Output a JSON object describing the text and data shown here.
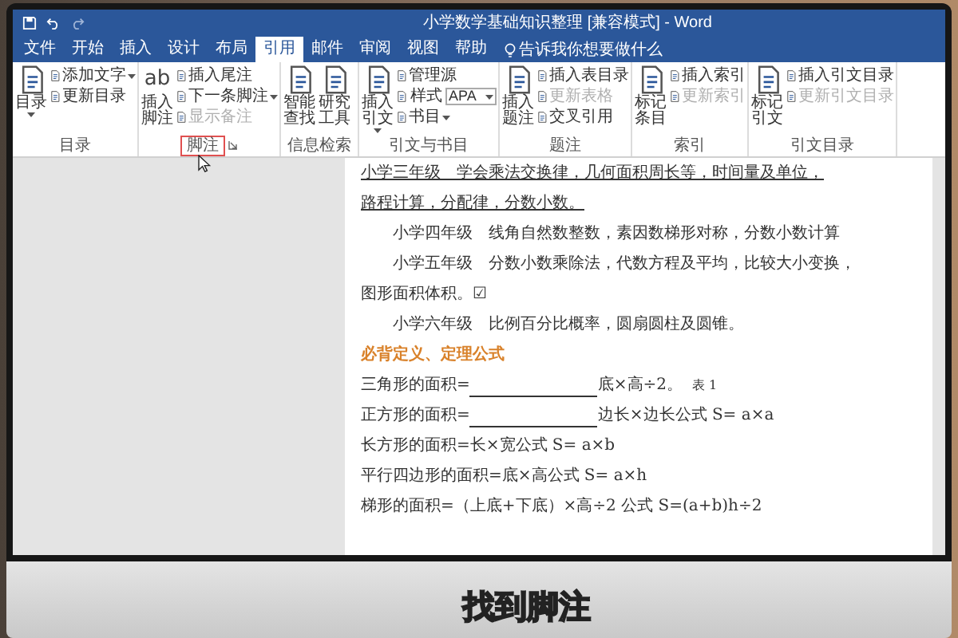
{
  "window": {
    "title": "小学数学基础知识整理 [兼容模式] - Word"
  },
  "tabs": [
    {
      "label": "文件",
      "selected": false
    },
    {
      "label": "开始",
      "selected": false
    },
    {
      "label": "插入",
      "selected": false
    },
    {
      "label": "设计",
      "selected": false
    },
    {
      "label": "布局",
      "selected": false
    },
    {
      "label": "引用",
      "selected": true
    },
    {
      "label": "邮件",
      "selected": false
    },
    {
      "label": "审阅",
      "selected": false
    },
    {
      "label": "视图",
      "selected": false
    },
    {
      "label": "帮助",
      "selected": false
    }
  ],
  "tell_me": "告诉我你想要做什么",
  "ribbon_groups": [
    {
      "label": "目录",
      "highlighted": false,
      "big": [
        {
          "label": "目录",
          "dropdown": true
        }
      ],
      "small": [
        {
          "label": "添加文字",
          "disabled": false,
          "dropdown": true
        },
        {
          "label": "更新目录",
          "disabled": false,
          "dropdown": false
        }
      ]
    },
    {
      "label": "脚注",
      "highlighted": true,
      "launcher": true,
      "big": [
        {
          "label": "插入脚注",
          "dropdown": false,
          "icon_text": "ab"
        }
      ],
      "small": [
        {
          "label": "插入尾注",
          "disabled": false,
          "dropdown": false
        },
        {
          "label": "下一条脚注",
          "disabled": false,
          "dropdown": true
        },
        {
          "label": "显示备注",
          "disabled": true,
          "dropdown": false
        }
      ]
    },
    {
      "label": "信息检索",
      "highlighted": false,
      "big": [
        {
          "label": "智能查找",
          "dropdown": false
        },
        {
          "label": "研究工具",
          "dropdown": false
        }
      ]
    },
    {
      "label": "引文与书目",
      "highlighted": false,
      "big": [
        {
          "label": "插入引文",
          "dropdown": true
        }
      ],
      "small": [
        {
          "label": "管理源",
          "disabled": false,
          "dropdown": false
        },
        {
          "label": "样式",
          "value": "APA"
        },
        {
          "label": "书目",
          "disabled": false,
          "dropdown": true
        }
      ]
    },
    {
      "label": "题注",
      "highlighted": false,
      "big": [
        {
          "label": "插入题注",
          "dropdown": false
        }
      ],
      "small": [
        {
          "label": "插入表目录",
          "disabled": false,
          "dropdown": false
        },
        {
          "label": "更新表格",
          "disabled": true,
          "dropdown": false
        },
        {
          "label": "交叉引用",
          "disabled": false,
          "dropdown": false
        }
      ]
    },
    {
      "label": "索引",
      "highlighted": false,
      "big": [
        {
          "label": "标记条目",
          "dropdown": false
        }
      ],
      "small": [
        {
          "label": "插入索引",
          "disabled": false,
          "dropdown": false
        },
        {
          "label": "更新索引",
          "disabled": true,
          "dropdown": false
        }
      ]
    },
    {
      "label": "引文目录",
      "highlighted": false,
      "big": [
        {
          "label": "标记引文",
          "dropdown": false
        }
      ],
      "small": [
        {
          "label": "插入引文目录",
          "disabled": false,
          "dropdown": false
        },
        {
          "label": "更新引文目录",
          "disabled": true,
          "dropdown": false
        }
      ]
    }
  ],
  "document": {
    "paragraphs": [
      {
        "kind": "underlined",
        "text": "小学三年级　学会乘法交换律，几何面积周长等，时间量及单位，"
      },
      {
        "kind": "underlined",
        "text": "路程计算，分配律，分数小数。"
      },
      {
        "kind": "indented",
        "text": "小学四年级　线角自然数整数，素因数梯形对称，分数小数计算"
      },
      {
        "kind": "indented",
        "text": "小学五年级　分数小数乘除法，代数方程及平均，比较大小变换，"
      },
      {
        "kind": "plain",
        "text": "图形面积体积。☑"
      },
      {
        "kind": "indented",
        "text": "小学六年级　比例百分比概率，圆扇圆柱及圆锥。"
      },
      {
        "kind": "heading",
        "text": "必背定义、定理公式"
      },
      {
        "kind": "fill_in",
        "text": "三角形的面积=",
        "rest": "底×高÷2。",
        "note": "表 1"
      },
      {
        "kind": "fill_in",
        "text": "正方形的面积=",
        "rest": "边长×边长公式 S= a×a"
      },
      {
        "kind": "plain",
        "text": "长方形的面积=长×宽公式 S= a×b"
      },
      {
        "kind": "plain",
        "text": "平行四边形的面积=底×高公式 S= a×h"
      },
      {
        "kind": "plain",
        "text": "梯形的面积=（上底+下底）×高÷2 公式 S=(a+b)h÷2"
      }
    ]
  },
  "caption": "找到脚注"
}
